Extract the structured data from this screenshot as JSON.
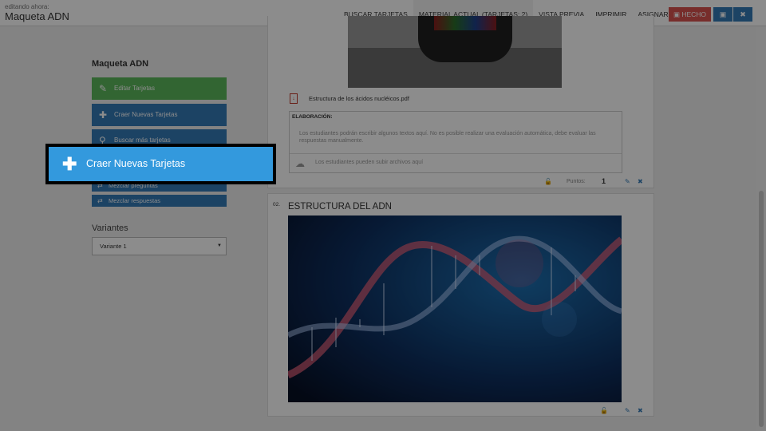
{
  "header": {
    "editing_label": "editando ahora:",
    "title": "Maqueta ADN",
    "nav": [
      {
        "label": "BUSCAR TARJETAS"
      },
      {
        "label": "MATERIAL ACTUAL (TARJETAS: 2)"
      },
      {
        "label": "VISTA PREVIA"
      },
      {
        "label": "IMPRIMIR"
      },
      {
        "label": "ASIGNAR"
      }
    ],
    "active_tab": "MATERIAL ACTUAL (TARJETAS: 2)",
    "done_label": "HECHO",
    "save_icon": "save-icon",
    "close_icon": "close-icon"
  },
  "sidebar": {
    "title": "Maqueta ADN",
    "buttons": [
      {
        "label": "Editar Tarjetas",
        "icon": "pencil-icon",
        "color": "#5cb85c"
      },
      {
        "label": "Craer Nuevas Tarjetas",
        "icon": "plus-icon",
        "color": "#337ab7"
      },
      {
        "label": "Buscar más tarjetas",
        "icon": "search-icon",
        "color": "#337ab7"
      },
      {
        "label": "Mezclar preguntas",
        "icon": "shuffle-icon",
        "color": "#337ab7"
      },
      {
        "label": "Mezclar respuestas",
        "icon": "shuffle-icon",
        "color": "#337ab7"
      }
    ],
    "variants_label": "Variantes",
    "variant_selected": "Variante 1"
  },
  "cards": [
    {
      "attachment": "Estructura de los ácidos nucléicos.pdf",
      "elaboration_title": "ELABORACIÓN:",
      "elaboration_text": "Los estudiantes podrán escribir algunos textos aquí. No es posible realizar una evaluación automática, debe evaluar las respuestas manualmente.",
      "upload_text": "Los estudiantes pueden subir archivos aquí",
      "points_label": "Puntos:",
      "points_value": "1"
    },
    {
      "number": "02.",
      "title": "ESTRUCTURA DEL ADN"
    }
  ],
  "highlight": {
    "label": "Craer Nuevas Tarjetas",
    "icon": "plus-icon",
    "color": "#3399dd"
  }
}
